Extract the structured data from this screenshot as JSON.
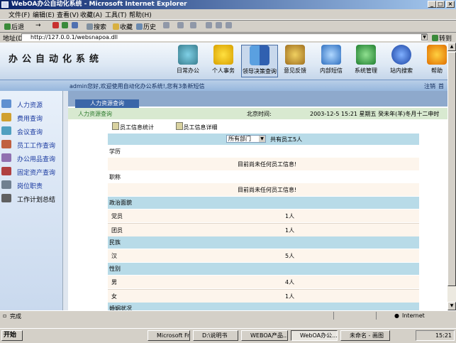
{
  "window": {
    "title": "WebOA办公自动化系统 - Microsoft Internet Explorer",
    "min": "_",
    "max": "□",
    "close": "×"
  },
  "menu": [
    "文件(F)",
    "编辑(E)",
    "查看(V)",
    "收藏(A)",
    "工具(T)",
    "帮助(H)"
  ],
  "toolbar": {
    "back": "后退",
    "forward": "→",
    "search": "搜索",
    "favorites": "收藏",
    "history": "历史"
  },
  "address": {
    "label": "地址(D)",
    "url": "http://127.0.0.1/websnapoa.dll",
    "go": "转到"
  },
  "app": {
    "title": "办公自动化系统",
    "nav": [
      {
        "label": "日常办公",
        "icon": "monitor-icon"
      },
      {
        "label": "个人事务",
        "icon": "running-man-icon"
      },
      {
        "label": "领导决策查询",
        "icon": "finder-icon"
      },
      {
        "label": "意见反馈",
        "icon": "feedback-icon"
      },
      {
        "label": "内部短信",
        "icon": "magnifier-icon"
      },
      {
        "label": "系统管理",
        "icon": "cubes-icon"
      },
      {
        "label": "站内搜索",
        "icon": "globe-icon"
      },
      {
        "label": "帮助",
        "icon": "help-icon"
      }
    ],
    "welcome": "admin您好,欢迎使用自动化办公系统!,您有3条新短信",
    "logout": "注销",
    "home": "首页"
  },
  "sidebar": [
    {
      "label": "人力资源",
      "icon": "people-icon"
    },
    {
      "label": "费用查询",
      "icon": "coins-icon"
    },
    {
      "label": "会议查询",
      "icon": "meeting-icon"
    },
    {
      "label": "员工工作查询",
      "icon": "worker-icon"
    },
    {
      "label": "办公用品查询",
      "icon": "supplies-icon"
    },
    {
      "label": "固定资产查询",
      "icon": "assets-icon"
    },
    {
      "label": "岗位职责",
      "icon": "duty-icon"
    },
    {
      "label": "工作计划总结",
      "icon": "plan-icon"
    }
  ],
  "main": {
    "tab": "人力资源查询",
    "subtitle": "人力资源查询",
    "beijing_label": "北京时间:",
    "beijing_value": "2003-12-5 15:21 星期五 癸未年(羊)冬月十二申时",
    "link_stats": "员工信息统计",
    "link_detail": "员工信息详细",
    "dept_value": "所有部门",
    "total": "共有员工5人",
    "sections": {
      "education": "学历",
      "no_info_1": "目前尚未任何员工信息!",
      "title": "职称",
      "no_info_2": "目前尚未任何员工信息!",
      "politics": "政治面貌",
      "party": "党员",
      "party_v": "1人",
      "league": "团员",
      "league_v": "1人",
      "nation": "民族",
      "han": "汉",
      "han_v": "5人",
      "gender": "性别",
      "male": "男",
      "male_v": "4人",
      "female": "女",
      "female_v": "1人",
      "marriage": "婚姻状况"
    }
  },
  "status": {
    "left": "完成",
    "zone": "Internet"
  },
  "taskbar": {
    "start": "开始",
    "tasks": [
      "Microsoft Fro...",
      "D:\\说明书",
      "WEBOA产品...",
      "WebOA办公...",
      "未命名 - 画图"
    ],
    "time": "15:21"
  }
}
